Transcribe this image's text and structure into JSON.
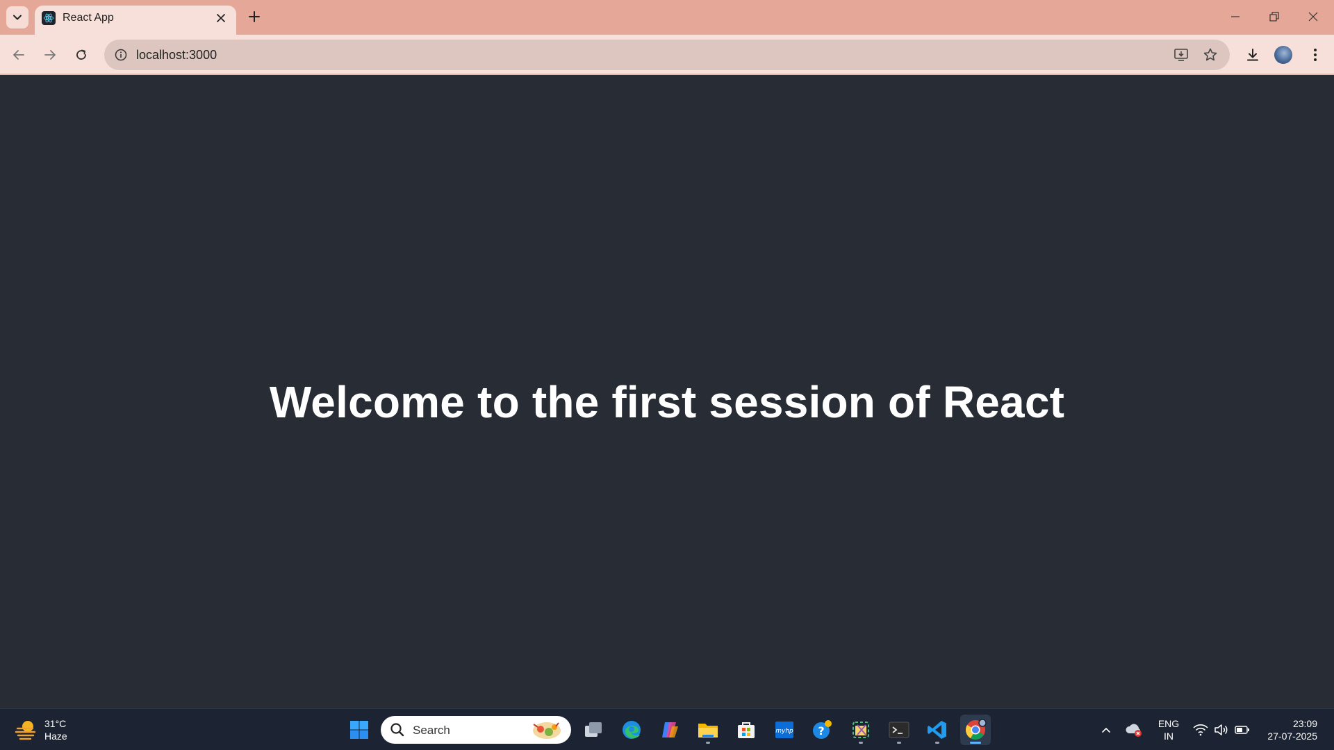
{
  "browser": {
    "tab_title": "React App",
    "url": "localhost:3000"
  },
  "page": {
    "headline": "Welcome to the first session of React"
  },
  "taskbar": {
    "weather_temp": "31°C",
    "weather_desc": "Haze",
    "search_placeholder": "Search",
    "lang_line1": "ENG",
    "lang_line2": "IN",
    "time": "23:09",
    "date": "27-07-2025"
  },
  "colors": {
    "tabstrip_bg": "#e5a898",
    "toolbar_bg": "#f7e0d9",
    "page_bg": "#282c34",
    "taskbar_bg": "#1c2433"
  },
  "icons": {
    "tab_search": "chevron-down-icon",
    "favicon": "react-icon",
    "back": "arrow-left-icon",
    "forward": "arrow-right-icon",
    "reload": "reload-icon",
    "site_info": "info-icon",
    "install": "install-app-icon",
    "bookmark": "star-icon",
    "downloads": "download-icon",
    "menu": "kebab-menu-icon"
  }
}
